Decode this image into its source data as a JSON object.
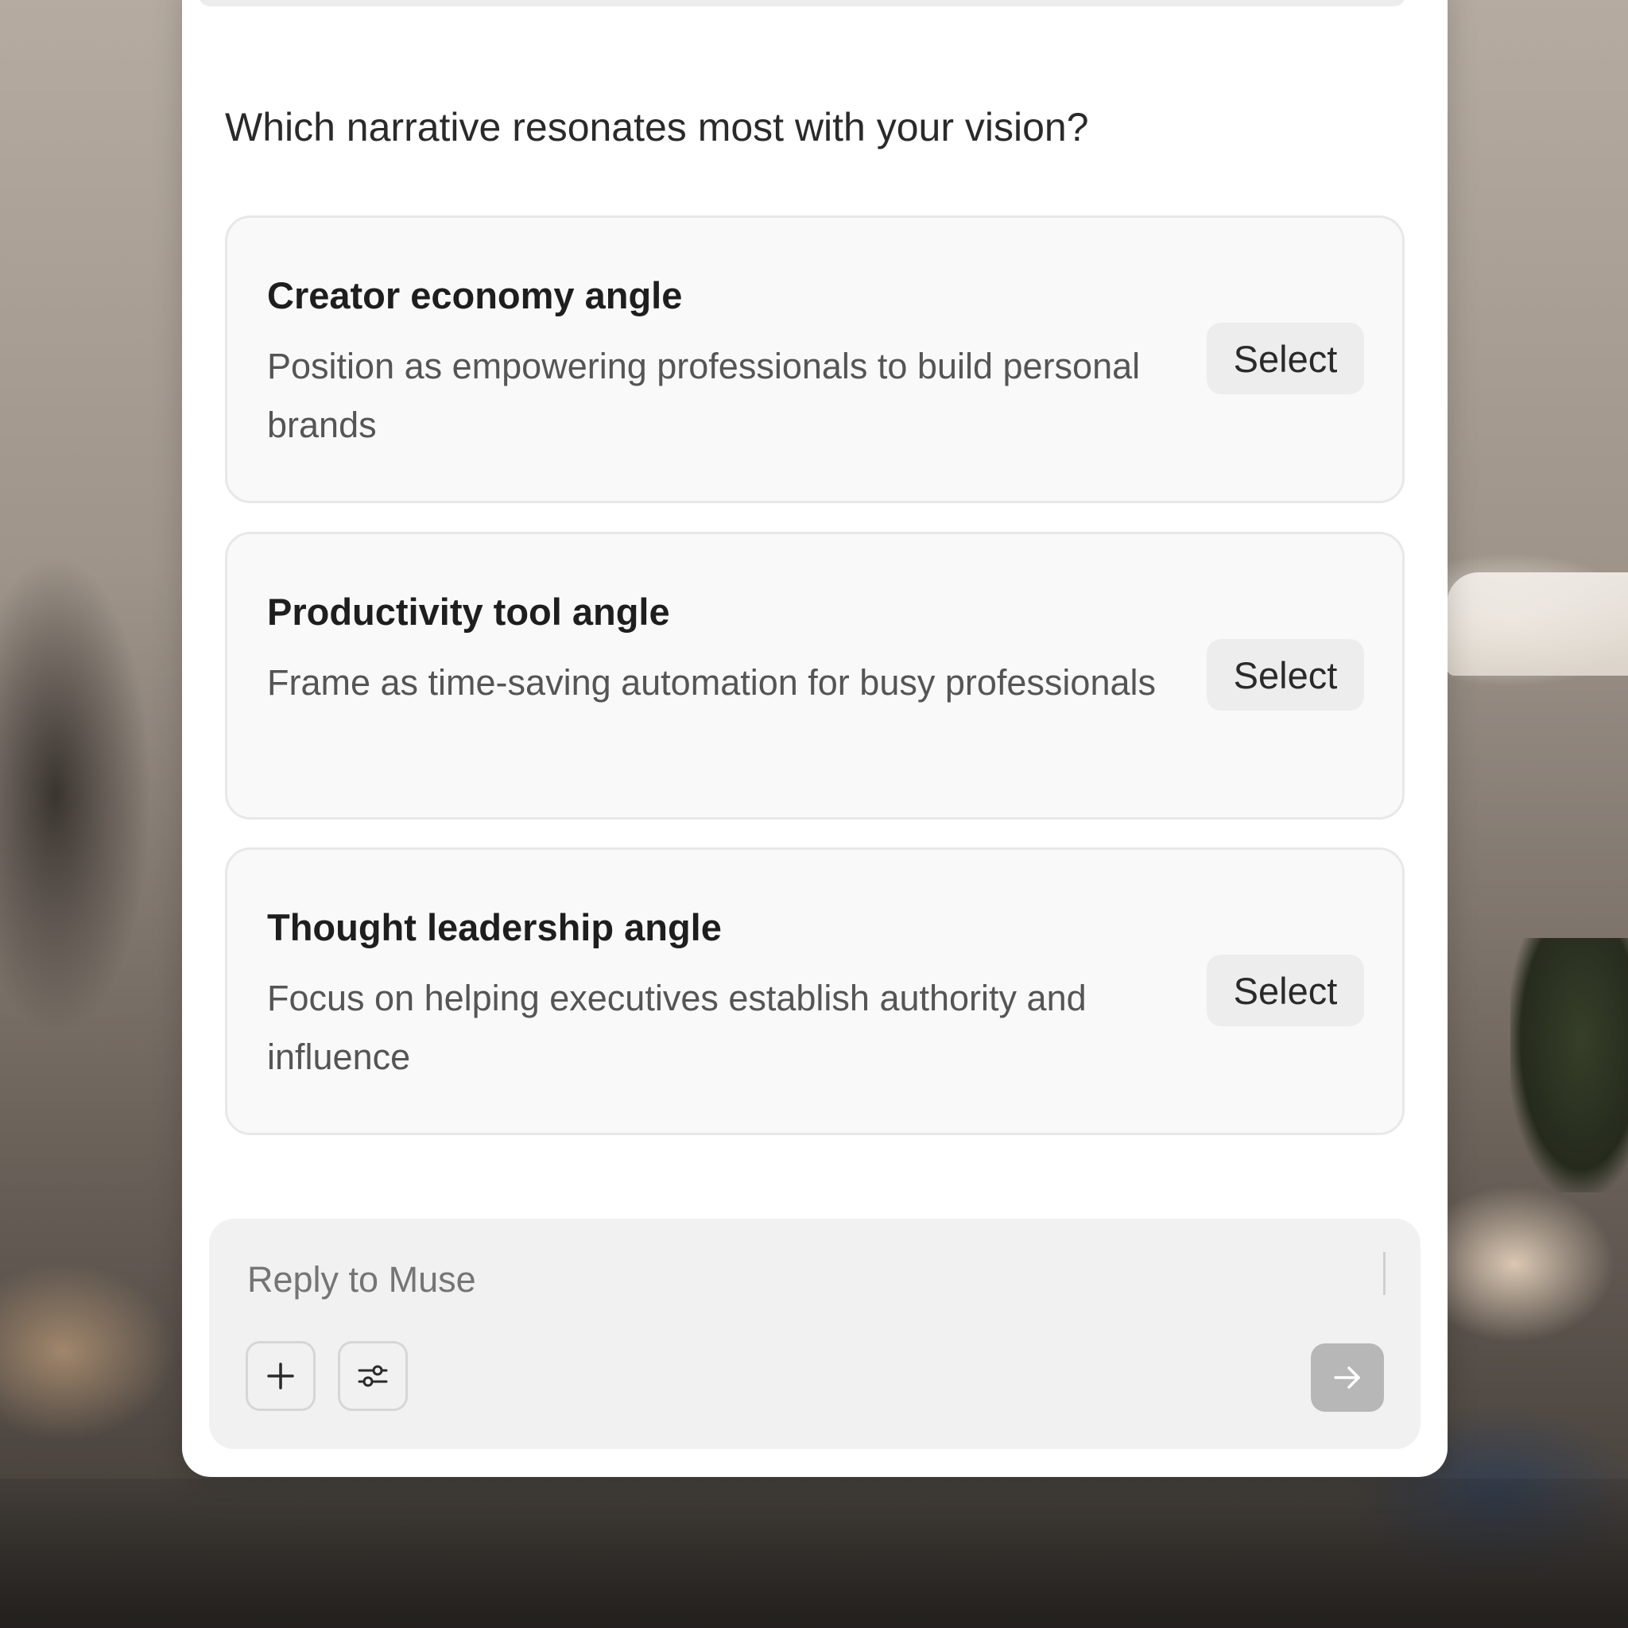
{
  "question": "Which narrative resonates most with your vision?",
  "options": [
    {
      "title": "Creator economy angle",
      "description": "Position as empowering professionals to build personal brands",
      "button_label": "Select"
    },
    {
      "title": "Productivity tool angle",
      "description": "Frame as time-saving automation for busy professionals",
      "button_label": "Select"
    },
    {
      "title": "Thought leadership angle",
      "description": "Focus on helping executives establish authority and influence",
      "button_label": "Select"
    }
  ],
  "composer": {
    "placeholder": "Reply to Muse",
    "buttons": {
      "add_icon": "plus-icon",
      "settings_icon": "sliders-icon",
      "send_icon": "arrow-right-icon"
    }
  }
}
